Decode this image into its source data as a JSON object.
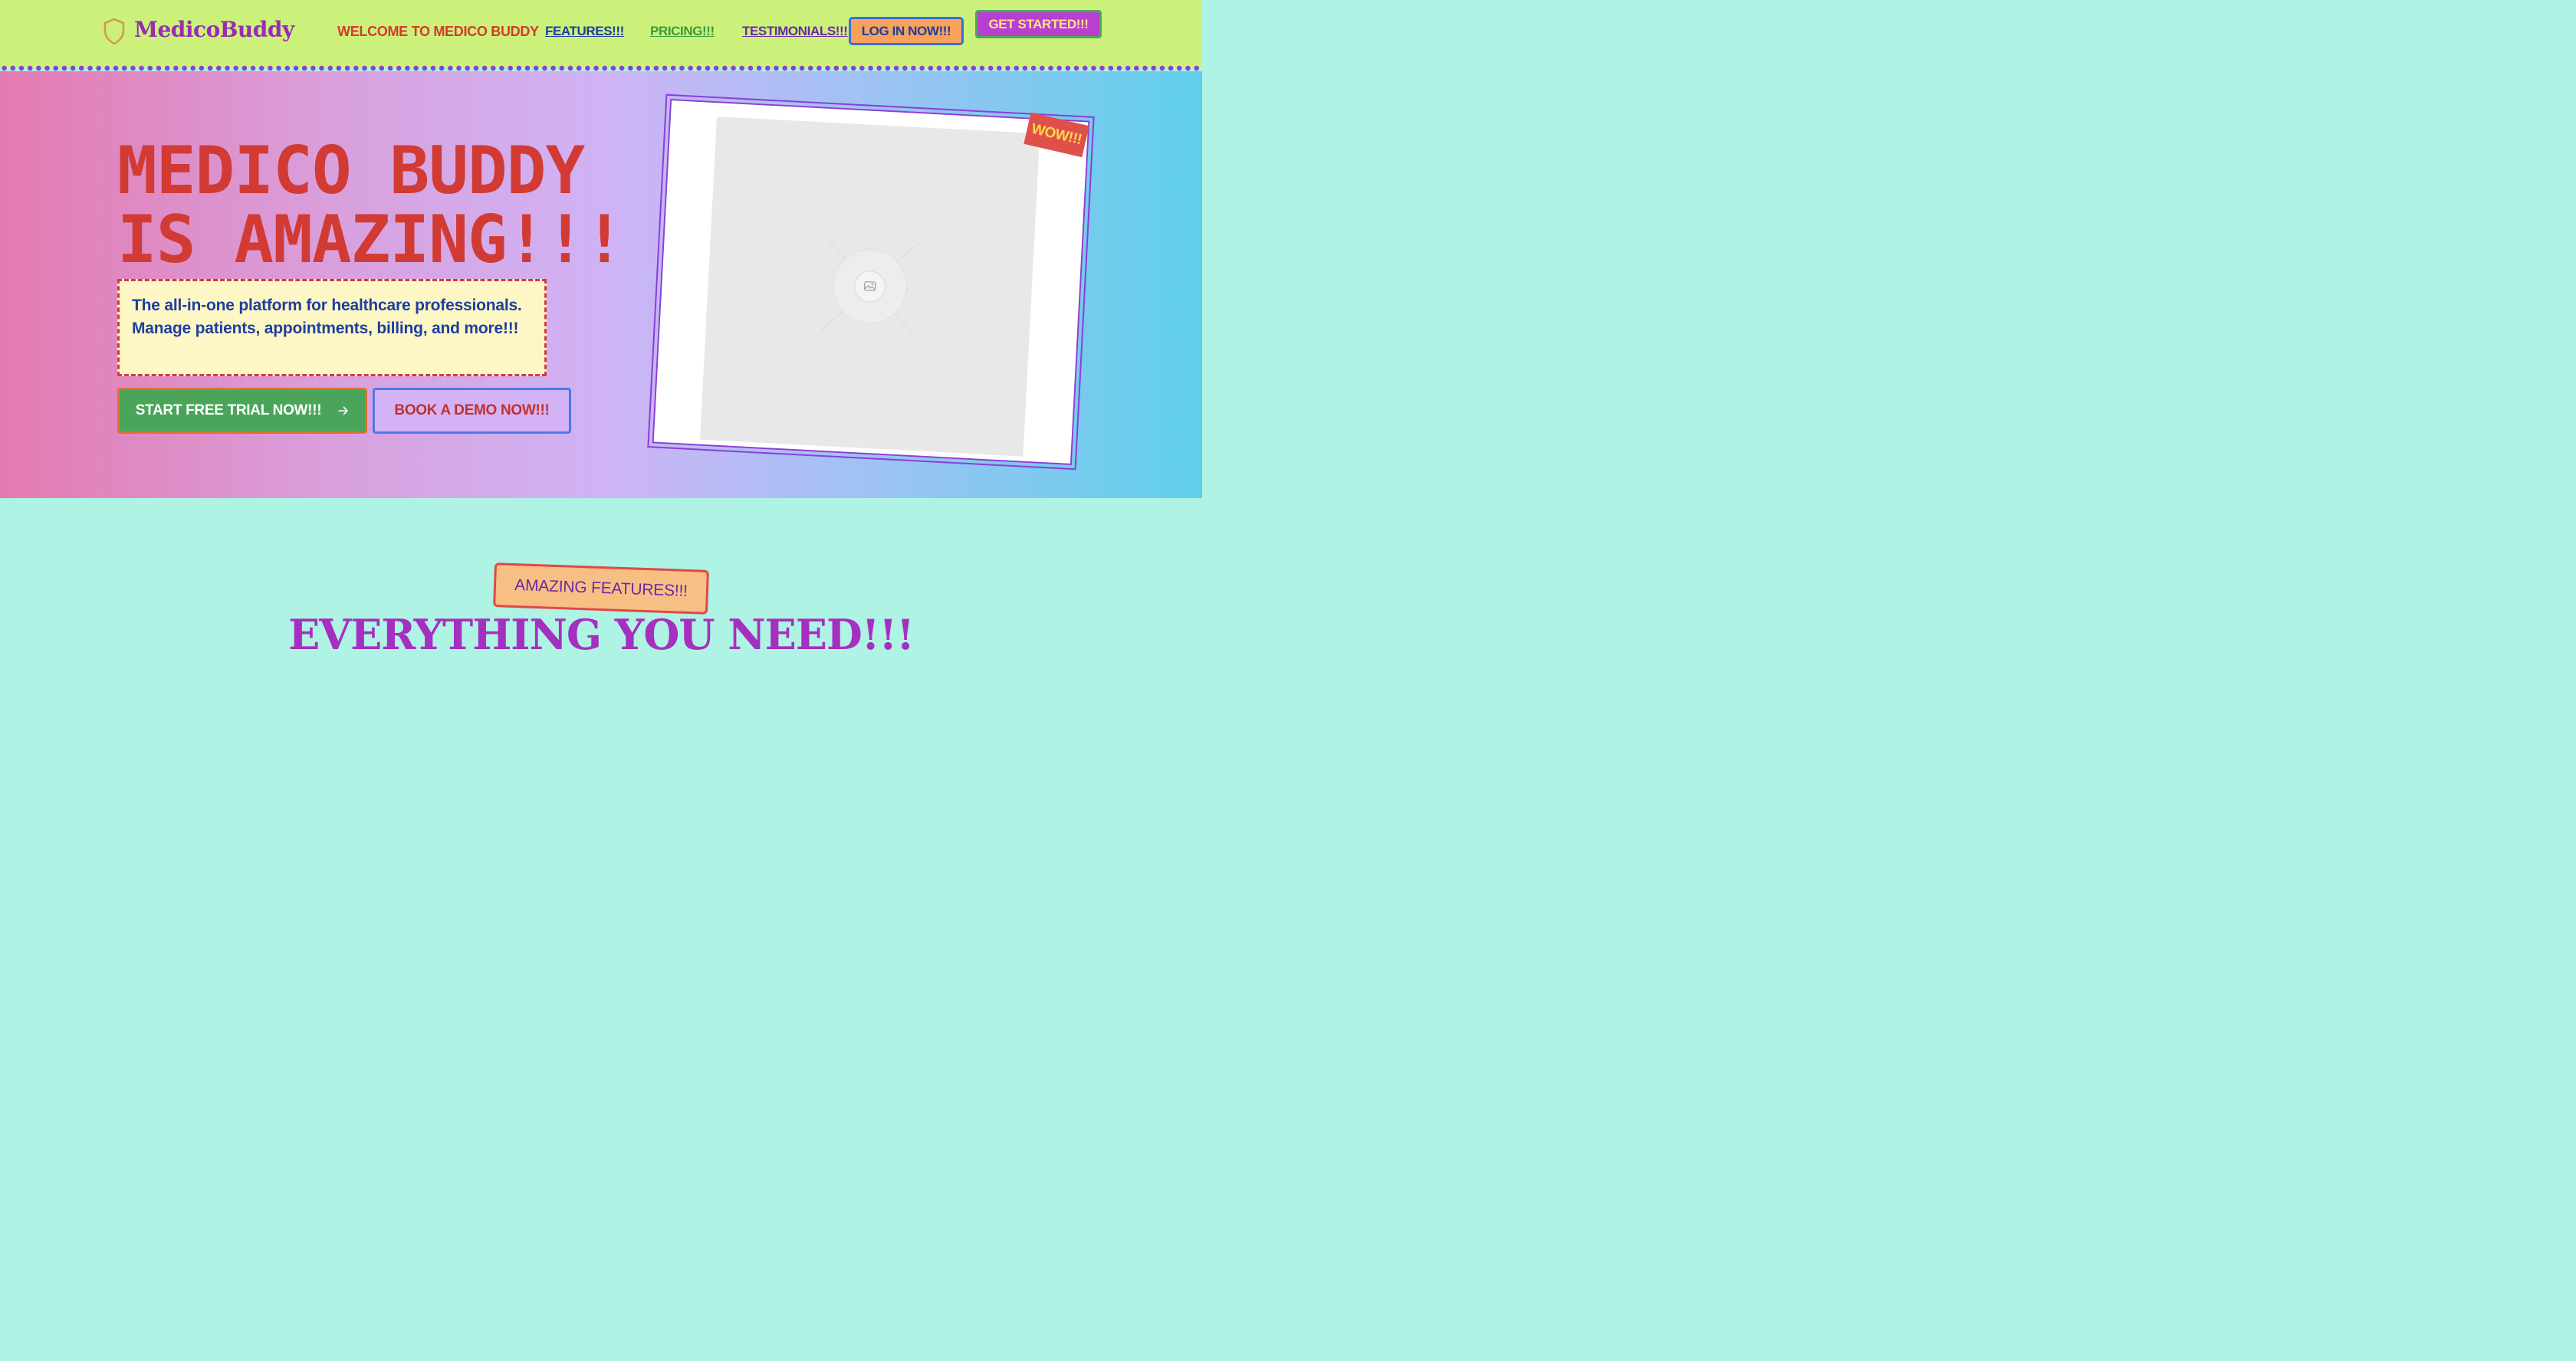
{
  "brand": {
    "name": "MedicoBuddy",
    "logo_icon": "shield-icon",
    "logo_color": "#d49a4a"
  },
  "nav": {
    "welcome": "WELCOME TO MEDICO BUDDY",
    "links": [
      {
        "label": "FEATURES!!!",
        "color": "#1e3ea0"
      },
      {
        "label": "PRICING!!!",
        "color": "#3a9a3a"
      },
      {
        "label": "TESTIMONIALS!!!",
        "color": "#6a2aa0"
      }
    ],
    "login_label": "LOG IN NOW!!!",
    "get_started_label": "GET STARTED!!!"
  },
  "hero": {
    "title_line1": "MEDICO BUDDY",
    "title_line2": "IS AMAZING!!!",
    "subtitle": "The all-in-one platform for healthcare professionals. Manage patients, appointments, billing, and more!!!",
    "primary_cta": "START FREE TRIAL NOW!!!",
    "primary_cta_icon": "arrow-right-icon",
    "secondary_cta": "BOOK A DEMO NOW!!!",
    "image_placeholder_icon": "image-icon",
    "badge": "WOW!!!"
  },
  "features": {
    "badge": "AMAZING FEATURES!!!",
    "title": "EVERYTHING YOU NEED!!!"
  },
  "colors": {
    "nav_bg": "#ccf17a",
    "accent_red": "#d23a34",
    "accent_purple": "#8a3fd6",
    "features_bg": "#aef3e4"
  }
}
